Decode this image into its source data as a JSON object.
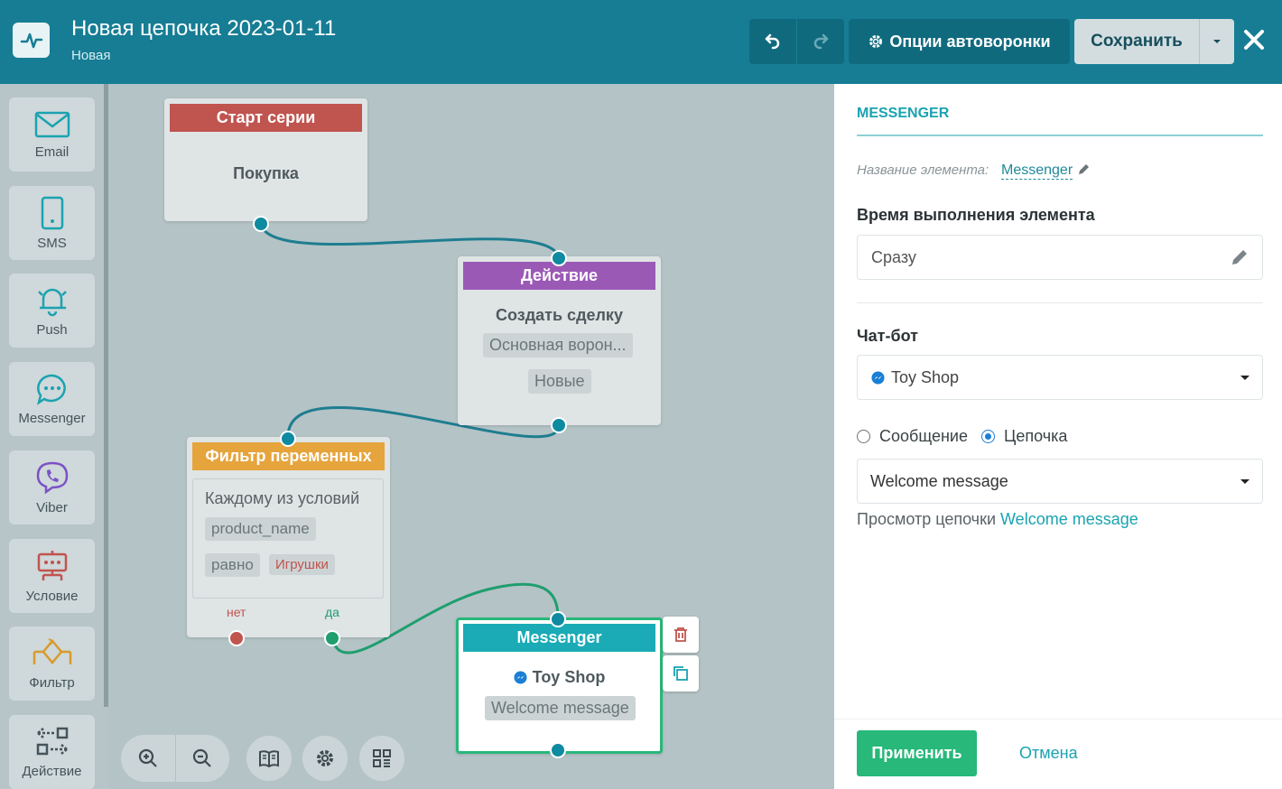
{
  "header": {
    "title": "Новая цепочка 2023-01-11",
    "status": "Новая",
    "options_label": "Опции автоворонки",
    "save_label": "Сохранить"
  },
  "toolbox": [
    {
      "label": "Email",
      "icon": "envelope-icon"
    },
    {
      "label": "SMS",
      "icon": "phone-icon"
    },
    {
      "label": "Push",
      "icon": "bell-icon"
    },
    {
      "label": "Messenger",
      "icon": "chat-icon"
    },
    {
      "label": "Viber",
      "icon": "viber-icon"
    },
    {
      "label": "Условие",
      "icon": "condition-icon"
    },
    {
      "label": "Фильтр",
      "icon": "filter-icon"
    },
    {
      "label": "Действие",
      "icon": "action-icon"
    }
  ],
  "nodes": {
    "start": {
      "title": "Старт серии",
      "text": "Покупка",
      "color": "#c0544f"
    },
    "action": {
      "title": "Действие",
      "text": "Создать сделку",
      "chip1": "Основная ворон...",
      "chip2": "Новые",
      "color": "#9b59b6"
    },
    "filter": {
      "title": "Фильтр переменных",
      "condition": "Каждому из условий",
      "variable": "product_name",
      "operator": "равно",
      "value": "Игрушки",
      "no_label": "нет",
      "yes_label": "да",
      "color": "#e6a43c"
    },
    "messenger": {
      "title": "Messenger",
      "bot": "Toy Shop",
      "chain": "Welcome message",
      "color": "#1aabb6"
    }
  },
  "panel": {
    "title": "MESSENGER",
    "name_label": "Название элемента:",
    "name_value": "Messenger",
    "time_label": "Время выполнения элемента",
    "time_value": "Сразу",
    "bot_label": "Чат-бот",
    "bot_value": "Toy Shop",
    "radio_message": "Сообщение",
    "radio_chain": "Цепочка",
    "radio_selected": "Цепочка",
    "chain_value": "Welcome message",
    "preview_text": "Просмотр цепочки",
    "preview_link": "Welcome message",
    "apply_label": "Применить",
    "cancel_label": "Отмена"
  },
  "colors": {
    "header": "#167d94",
    "accent": "#1aa3b0",
    "apply": "#27b87a"
  }
}
